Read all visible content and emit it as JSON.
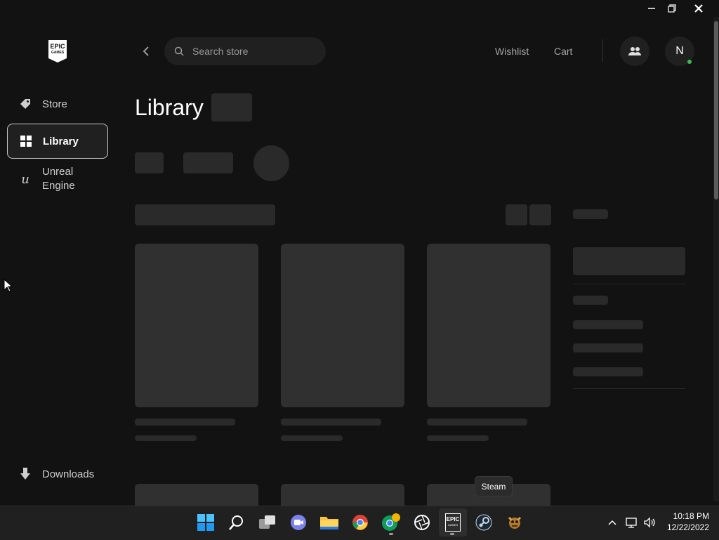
{
  "window": {
    "minimize_icon": "minimize-icon",
    "restore_icon": "restore-icon",
    "close_icon": "close-icon"
  },
  "brand": {
    "logo_line1": "EPIC",
    "logo_line2": "GAMES"
  },
  "sidebar": {
    "items": [
      {
        "label": "Store",
        "icon": "tag-icon"
      },
      {
        "label": "Library",
        "icon": "grid-icon",
        "active": true
      },
      {
        "label_line1": "Unreal",
        "label_line2": "Engine",
        "icon": "unreal-icon"
      }
    ],
    "downloads": {
      "label": "Downloads",
      "icon": "download-icon"
    }
  },
  "header": {
    "search_placeholder": "Search store",
    "wishlist": "Wishlist",
    "cart": "Cart",
    "avatar_initial": "N"
  },
  "page": {
    "title": "Library"
  },
  "taskbar": {
    "tooltip": "Steam",
    "epic_line1": "EPIC",
    "epic_line2": "GAMES",
    "clock_time": "10:18 PM",
    "clock_date": "12/22/2022"
  },
  "colors": {
    "online": "#3fb950",
    "background": "#121212",
    "skeleton": "#2a2a2a"
  }
}
